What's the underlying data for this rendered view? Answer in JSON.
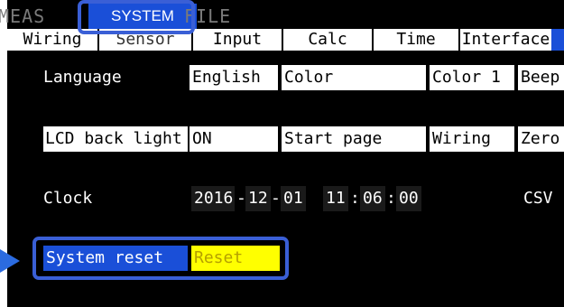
{
  "mode_tabs": {
    "meas": "MEAS",
    "system": "SYSTEM",
    "file": "FILE"
  },
  "sub_tabs": [
    "Wiring",
    "Sensor",
    "Input",
    "Calc",
    "Time",
    "Interface"
  ],
  "rows": {
    "language_label": "Language",
    "language_value": "English",
    "color_label": "Color",
    "color_value": "Color 1",
    "beep_label": "Beep",
    "lcd_label": "LCD back light",
    "lcd_value": "ON",
    "start_page_label": "Start page",
    "start_page_value": "Wiring",
    "zero_label": "Zero",
    "clock_label": "Clock",
    "clock_year": "2016",
    "clock_month": "12",
    "clock_day": "01",
    "clock_hour": "11",
    "clock_min": "06",
    "clock_sec": "00",
    "date_sep": "-",
    "time_sep": ":",
    "csv_label": "CSV",
    "system_reset_label": "System reset",
    "system_reset_value": "Reset"
  },
  "colors": {
    "selection_blue": "#1a4fd8",
    "highlight_yellow": "#ffff00",
    "annotation_blue": "#3a5fd6"
  }
}
